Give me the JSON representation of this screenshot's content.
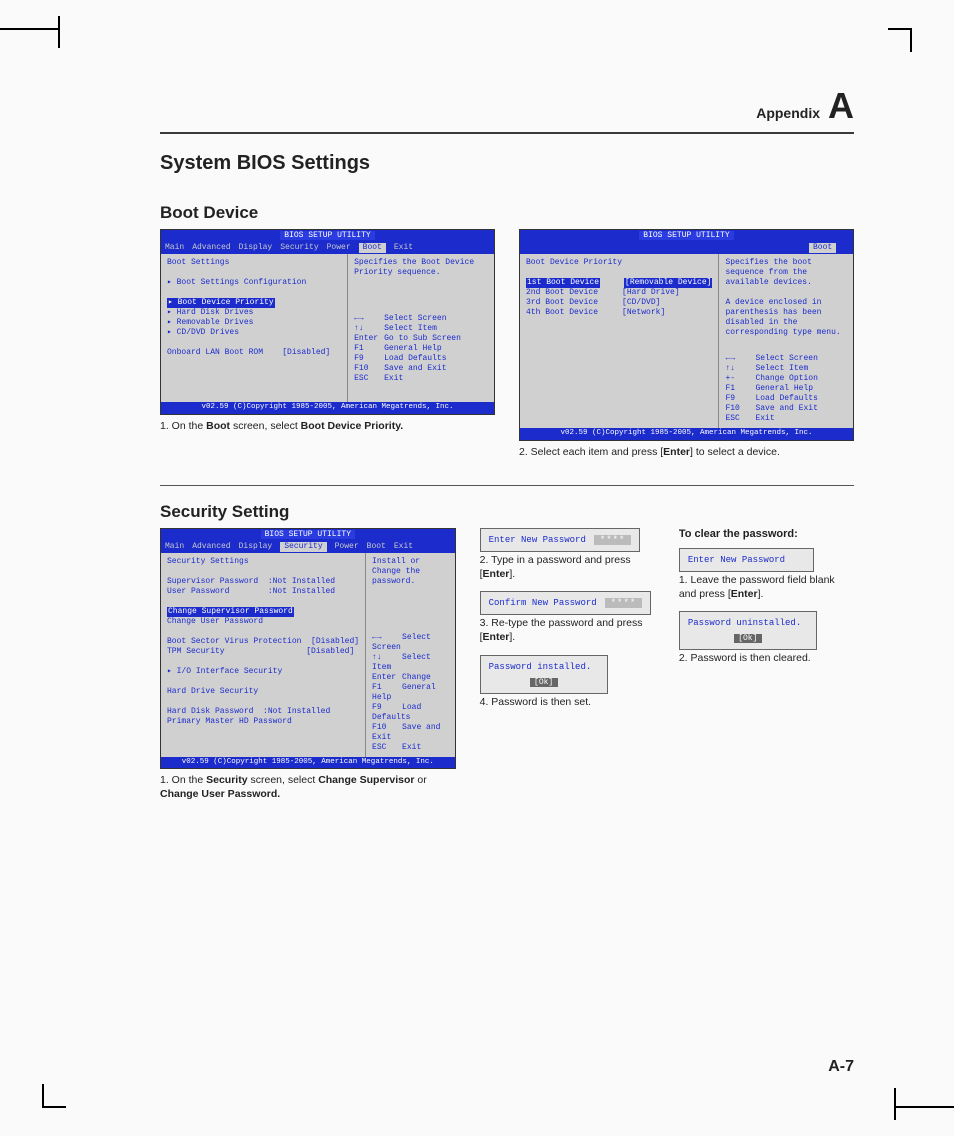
{
  "header": {
    "appendix": "Appendix",
    "letter": "A"
  },
  "title": "System BIOS Settings",
  "page_number": "A-7",
  "sections": {
    "boot": {
      "heading": "Boot Device",
      "caption1_pre": "1. On the ",
      "caption1_b1": "Boot",
      "caption1_mid": " screen, select ",
      "caption1_b2": "Boot Device Priority.",
      "caption2_pre": "2. Select each item and press [",
      "caption2_b": "Enter",
      "caption2_post": "] to select a device."
    },
    "security": {
      "heading": "Security Setting",
      "caption1_pre": "1. On the ",
      "caption1_b1": "Security",
      "caption1_mid": " screen, select ",
      "caption1_b2": "Change Supervisor",
      "caption1_mid2": " or ",
      "caption1_b3": "Change User Password.",
      "step2_pre": "2. Type in a password and press [",
      "step2_b": "Enter",
      "step2_post": "].",
      "step3_pre": "3. Re-type the password and press [",
      "step3_b": "Enter",
      "step3_post": "].",
      "step4": "4. Password is then set.",
      "clear_heading": "To clear the password:",
      "clear1_pre": "1. Leave the password field blank and press [",
      "clear1_b": "Enter",
      "clear1_post": "].",
      "clear2": "2. Password is then cleared."
    }
  },
  "bios": {
    "util_title": "BIOS SETUP UTILITY",
    "copyright": "v02.59 (C)Copyright 1985-2005, American Megatrends, Inc.",
    "menus": [
      "Main",
      "Advanced",
      "Display",
      "Security",
      "Power",
      "Boot",
      "Exit"
    ],
    "boot_screen": {
      "active_menu": "Boot",
      "title": "Boot Settings",
      "items": [
        "Boot Settings Configuration",
        "Boot Device Priority",
        "Hard Disk Drives",
        "Removable Drives",
        "CD/DVD Drives"
      ],
      "extra_label": "Onboard LAN Boot ROM",
      "extra_value": "[Disabled]",
      "help": "Specifies the Boot Device Priority sequence."
    },
    "priority_screen": {
      "active_menu": "Boot",
      "title": "Boot Device Priority",
      "rows": [
        {
          "label": "1st Boot Device",
          "value": "[Removable Device]"
        },
        {
          "label": "2nd Boot Device",
          "value": "[Hard Drive]"
        },
        {
          "label": "3rd Boot Device",
          "value": "[CD/DVD]"
        },
        {
          "label": "4th Boot Device",
          "value": "[Network]"
        }
      ],
      "help": "Specifies the boot sequence from the available devices.\n\nA device enclosed in parenthesis has been disabled in the corresponding type menu."
    },
    "security_screen": {
      "active_menu": "Security",
      "title": "Security Settings",
      "rows1": [
        {
          "label": "Supervisor Password",
          "value": ":Not Installed"
        },
        {
          "label": "User Password",
          "value": ":Not Installed"
        }
      ],
      "change_items": [
        "Change Supervisor Password",
        "Change User Password"
      ],
      "rows2": [
        {
          "label": "Boot Sector Virus Protection",
          "value": "[Disabled]"
        },
        {
          "label": "TPM Security",
          "value": "[Disabled]"
        }
      ],
      "io_item": "I/O Interface Security",
      "hd_title": "Hard Drive Security",
      "rows3": [
        {
          "label": "Hard Disk Password",
          "value": ":Not Installed"
        }
      ],
      "hd_item": "Primary Master HD Password",
      "help": "Install or Change the password."
    },
    "nav_help_boot": [
      {
        "k": "←→",
        "v": "Select Screen"
      },
      {
        "k": "↑↓",
        "v": "Select Item"
      },
      {
        "k": "Enter",
        "v": "Go to Sub Screen"
      },
      {
        "k": "F1",
        "v": "General Help"
      },
      {
        "k": "F9",
        "v": "Load Defaults"
      },
      {
        "k": "F10",
        "v": "Save and Exit"
      },
      {
        "k": "ESC",
        "v": "Exit"
      }
    ],
    "nav_help_priority": [
      {
        "k": "←→",
        "v": "Select Screen"
      },
      {
        "k": "↑↓",
        "v": "Select Item"
      },
      {
        "k": "+-",
        "v": "Change Option"
      },
      {
        "k": "F1",
        "v": "General Help"
      },
      {
        "k": "F9",
        "v": "Load Defaults"
      },
      {
        "k": "F10",
        "v": "Save and Exit"
      },
      {
        "k": "ESC",
        "v": "Exit"
      }
    ],
    "nav_help_security": [
      {
        "k": "←→",
        "v": "Select Screen"
      },
      {
        "k": "↑↓",
        "v": "Select Item"
      },
      {
        "k": "Enter",
        "v": "Change"
      },
      {
        "k": "F1",
        "v": "General Help"
      },
      {
        "k": "F9",
        "v": "Load Defaults"
      },
      {
        "k": "F10",
        "v": "Save and Exit"
      },
      {
        "k": "ESC",
        "v": "Exit"
      }
    ]
  },
  "dialogs": {
    "enter_new": "Enter New Password",
    "confirm": "Confirm New Password",
    "masked": "****",
    "blank": "    ",
    "installed": "Password installed.",
    "uninstalled": "Password uninstalled.",
    "ok": "[Ok]"
  }
}
